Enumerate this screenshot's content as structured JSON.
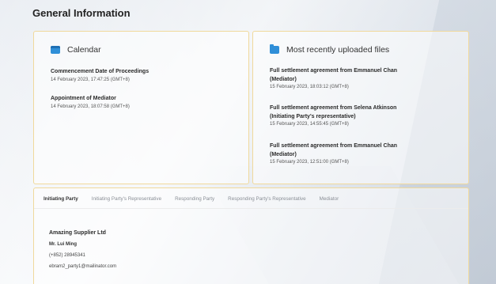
{
  "page": {
    "title": "General Information"
  },
  "calendar": {
    "heading": "Calendar",
    "icon": "calendar-icon",
    "events": [
      {
        "title": "Commencement Date of Proceedings",
        "date": "14 February 2023, 17:47:25 (GMT+8)"
      },
      {
        "title": "Appointment of Mediator",
        "date": "14 February 2023, 18:07:58 (GMT+8)"
      }
    ]
  },
  "files": {
    "heading": "Most recently uploaded files",
    "icon": "folder-icon",
    "items": [
      {
        "title_line1": "Full settlement agreement from Emmanuel Chan",
        "title_line2": "(Mediator)",
        "date": "15 February 2023, 18:03:12 (GMT+8)"
      },
      {
        "title_line1": "Full settlement agreement from Selena Atkinson",
        "title_line2": "(Initiating Party's representative)",
        "date": "15 February 2023, 14:55:45 (GMT+8)"
      },
      {
        "title_line1": "Full settlement agreement from Emmanuel Chan",
        "title_line2": "(Mediator)",
        "date": "15 February 2023, 12:51:00 (GMT+8)"
      }
    ]
  },
  "tabs": {
    "items": [
      "Initiating Party",
      "Initiating Party's Representative",
      "Responding Party",
      "Responding Party's Representative",
      "Mediator"
    ],
    "active_index": 0
  },
  "party": {
    "company": "Amazing Supplier Ltd",
    "contact_name": "Mr. Lui Ming",
    "phone": "(+852) 28945341",
    "email": "ebram2_party1@mailinator.com"
  },
  "colors": {
    "accent": "#3f6fd1",
    "icon_blue": "#2f8fd8",
    "card_border": "#f0d99c"
  }
}
